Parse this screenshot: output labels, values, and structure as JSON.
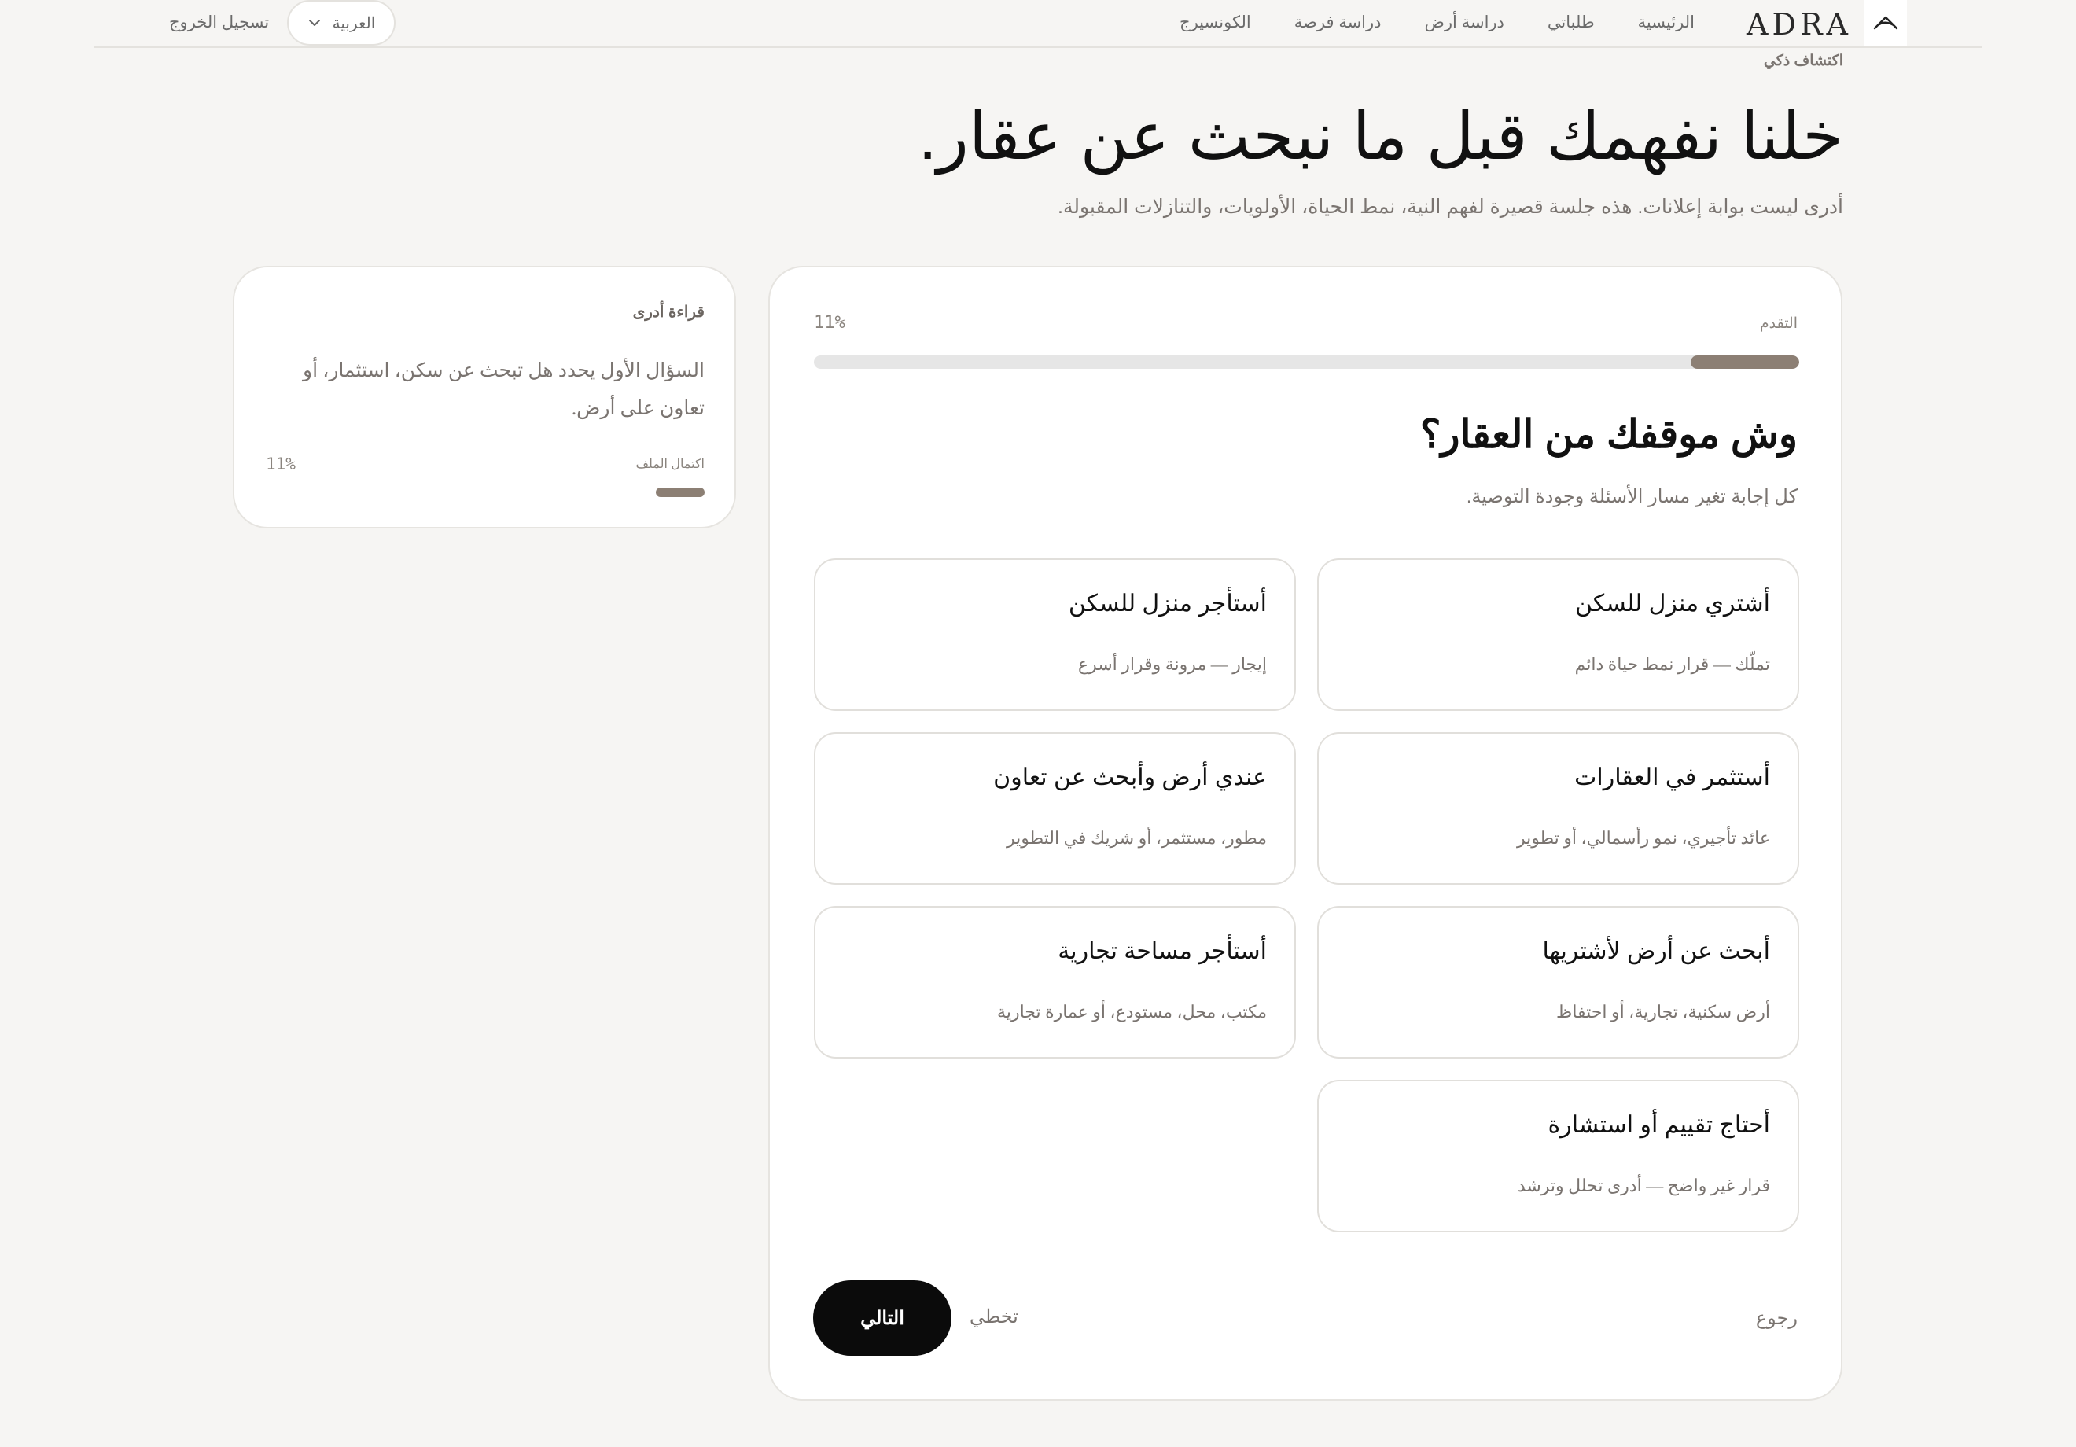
{
  "header": {
    "logo_text": "ADRA",
    "nav": [
      "الرئيسية",
      "طلباتي",
      "دراسة أرض",
      "دراسة فرصة",
      "الكونسيرج"
    ],
    "language": "العربية",
    "logout": "تسجيل الخروج"
  },
  "hero": {
    "eyebrow": "اكتشاف ذكي",
    "title": "خلنا نفهمك قبل ما نبحث عن عقار.",
    "subtitle": "أدرى ليست بوابة إعلانات. هذه جلسة قصيرة لفهم النية، نمط الحياة، الأولويات، والتنازلات المقبولة."
  },
  "questionnaire": {
    "progress_label": "التقدم",
    "progress_value": "11%",
    "progress_fraction": 0.11,
    "question": "وش موقفك من العقار؟",
    "question_sub": "كل إجابة تغير مسار الأسئلة وجودة التوصية.",
    "options": [
      {
        "title": "أشتري منزل للسكن",
        "desc": "تملّك — قرار نمط حياة دائم"
      },
      {
        "title": "أستأجر منزل للسكن",
        "desc": "إيجار — مرونة وقرار أسرع"
      },
      {
        "title": "أستثمر في العقارات",
        "desc": "عائد تأجيري، نمو رأسمالي، أو تطوير"
      },
      {
        "title": "عندي أرض وأبحث عن تعاون",
        "desc": "مطور، مستثمر، أو شريك في التطوير"
      },
      {
        "title": "أبحث عن أرض لأشتريها",
        "desc": "أرض سكنية، تجارية، أو احتفاظ"
      },
      {
        "title": "أستأجر مساحة تجارية",
        "desc": "مكتب، محل، مستودع، أو عمارة تجارية"
      },
      {
        "title": "أحتاج تقييم أو استشارة",
        "desc": "قرار غير واضح — أدرى تحلل وترشد"
      }
    ],
    "next": "التالي",
    "skip": "تخطي",
    "back": "رجوع"
  },
  "side": {
    "title": "قراءة أدرى",
    "text": "السؤال الأول يحدد هل تبحث عن سكن، استثمار، أو تعاون على أرض.",
    "completion_label": "اكتمال الملف",
    "completion_value": "11%",
    "completion_fraction": 0.11
  }
}
